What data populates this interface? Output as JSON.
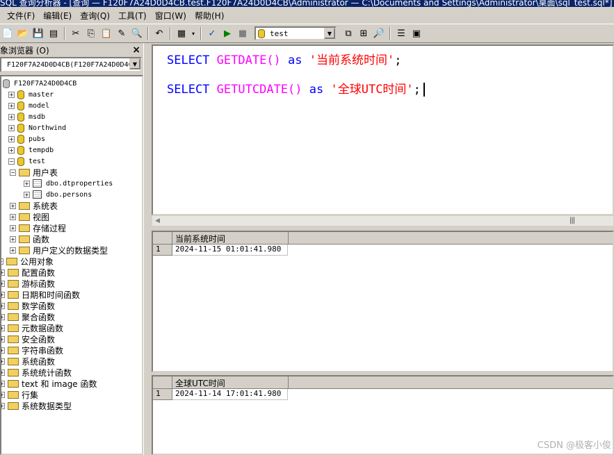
{
  "window": {
    "title": "SQL 查询分析器 - [查询 — F120F7A24D0D4CB.test.F120F7A24D0D4CB\\Administrator — C:\\Documents and Settings\\Administrator\\桌面\\sql_test.sql*]"
  },
  "menu": [
    "文件(F)",
    "编辑(E)",
    "查询(Q)",
    "工具(T)",
    "窗口(W)",
    "帮助(H)"
  ],
  "toolbar": {
    "database": "test"
  },
  "object_browser": {
    "title": "象浏览器 (O)",
    "close": "×",
    "server_combo": "F120F7A24D0D4CB(F120F7A24D0D4C",
    "server": "F120F7A24D0D4CB",
    "databases": [
      "master",
      "model",
      "msdb",
      "Northwind",
      "pubs",
      "tempdb",
      "test"
    ],
    "test_children": {
      "user_tables": "用户表",
      "tables": [
        "dbo.dtproperties",
        "dbo.persons"
      ],
      "folders": [
        "系统表",
        "视图",
        "存储过程",
        "函数",
        "用户定义的数据类型"
      ]
    },
    "public_objects": "公用对象",
    "public_folders": [
      "配置函数",
      "游标函数",
      "日期和时间函数",
      "数学函数",
      "聚合函数",
      "元数据函数",
      "安全函数",
      "字符串函数",
      "系统函数",
      "系统统计函数",
      "text 和 image 函数",
      "行集",
      "系统数据类型"
    ]
  },
  "editor": {
    "line1": {
      "kw": "SELECT",
      "fn": "GETDATE()",
      "as": "as",
      "str": "'当前系统时间'",
      "end": ";"
    },
    "line2": {
      "kw": "SELECT",
      "fn": "GETUTCDATE()",
      "as": "as",
      "str": "'全球UTC时间'",
      "end": ";"
    }
  },
  "results": [
    {
      "column": "当前系统时间",
      "row": "1",
      "value": "2024-11-15 01:01:41.980"
    },
    {
      "column": "全球UTC时间",
      "row": "1",
      "value": "2024-11-14 17:01:41.980"
    }
  ],
  "watermark": "CSDN @极客小俊"
}
